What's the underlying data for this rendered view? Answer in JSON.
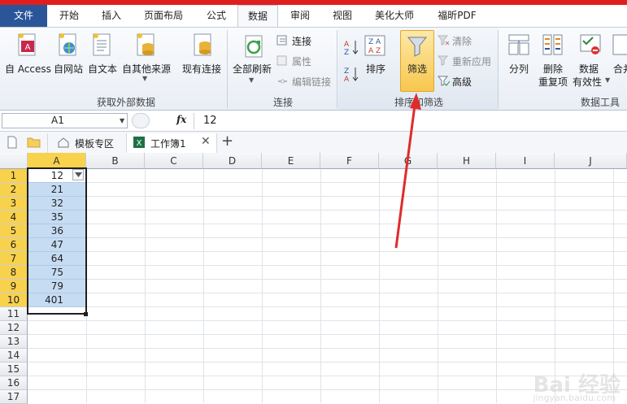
{
  "tabs": [
    {
      "label": "文件"
    },
    {
      "label": "开始"
    },
    {
      "label": "插入"
    },
    {
      "label": "页面布局"
    },
    {
      "label": "公式"
    },
    {
      "label": "数据"
    },
    {
      "label": "审阅"
    },
    {
      "label": "视图"
    },
    {
      "label": "美化大师"
    },
    {
      "label": "福昕PDF"
    }
  ],
  "ribbon": {
    "get_external": {
      "access": "自 Access",
      "web": "自网站",
      "text": "自文本",
      "other": "自其他来源",
      "existing": "现有连接",
      "title": "获取外部数据"
    },
    "connections": {
      "refresh_all": "全部刷新",
      "connect": "连接",
      "properties": "属性",
      "edit_links": "编辑链接",
      "title": "连接"
    },
    "sort_filter": {
      "sort": "排序",
      "filter": "筛选",
      "clear": "清除",
      "reapply": "重新应用",
      "advanced": "高级",
      "title": "排序和筛选"
    },
    "data_tools": {
      "split": "分列",
      "remove_dup_1": "删除",
      "remove_dup_2": "重复项",
      "validation_1": "数据",
      "validation_2": "有效性",
      "merge": "合并",
      "title": "数据工具"
    }
  },
  "formula_bar": {
    "name_box": "A1",
    "fx": "fx",
    "value": "12"
  },
  "doc_tabs": {
    "template": "模板专区",
    "workbook": "工作簿1",
    "add": "+"
  },
  "columns": [
    "A",
    "B",
    "C",
    "D",
    "E",
    "F",
    "G",
    "H",
    "I",
    "J"
  ],
  "rows": [
    "1",
    "2",
    "3",
    "4",
    "5",
    "6",
    "7",
    "8",
    "9",
    "10",
    "11",
    "12",
    "13",
    "14",
    "15",
    "16",
    "17"
  ],
  "cells_A": [
    "12",
    "21",
    "32",
    "35",
    "36",
    "47",
    "64",
    "75",
    "79",
    "401"
  ],
  "watermark": "Bai 经验",
  "watermark_sub": "jingyan.baidu.com"
}
